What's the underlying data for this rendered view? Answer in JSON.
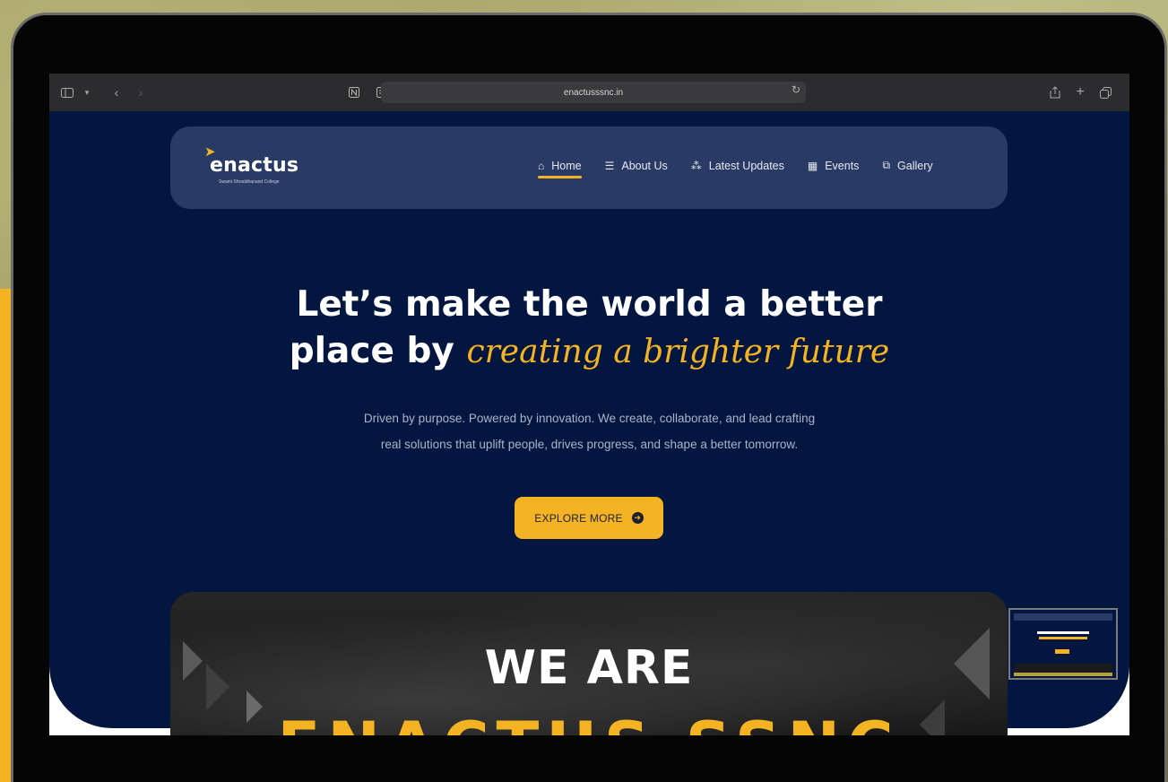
{
  "browser": {
    "url": "enactusssnc.in",
    "icons": [
      "sidebar-icon",
      "chevron-down-icon",
      "back-icon",
      "forward-icon",
      "notion-icon",
      "reader-icon",
      "reload-icon",
      "share-icon",
      "new-tab-icon",
      "tabs-overview-icon"
    ]
  },
  "brand": {
    "name": "enactus",
    "subtitle": "Swami Shraddhanand College",
    "accent_color": "#f4b323",
    "navy": "#03163f"
  },
  "nav": {
    "items": [
      {
        "label": "Home",
        "icon": "home-icon",
        "active": true
      },
      {
        "label": "About Us",
        "icon": "list-icon",
        "active": false
      },
      {
        "label": "Latest Updates",
        "icon": "cluster-icon",
        "active": false
      },
      {
        "label": "Events",
        "icon": "calendar-icon",
        "active": false
      },
      {
        "label": "Gallery",
        "icon": "gallery-icon",
        "active": false
      }
    ]
  },
  "hero": {
    "headline_line1": "Let’s make the world a better",
    "headline_line2_lead": "place by",
    "headline_line2_accent": "creating a brighter future",
    "subtext_line1": "Driven by purpose. Powered by innovation. We create, collaborate, and lead crafting",
    "subtext_line2": "real solutions that uplift people, drives progress, and shape a better tomorrow.",
    "cta_label": "EXPLORE MORE"
  },
  "banner": {
    "line1": "WE ARE",
    "line2": "ENACTUS SSNC"
  }
}
